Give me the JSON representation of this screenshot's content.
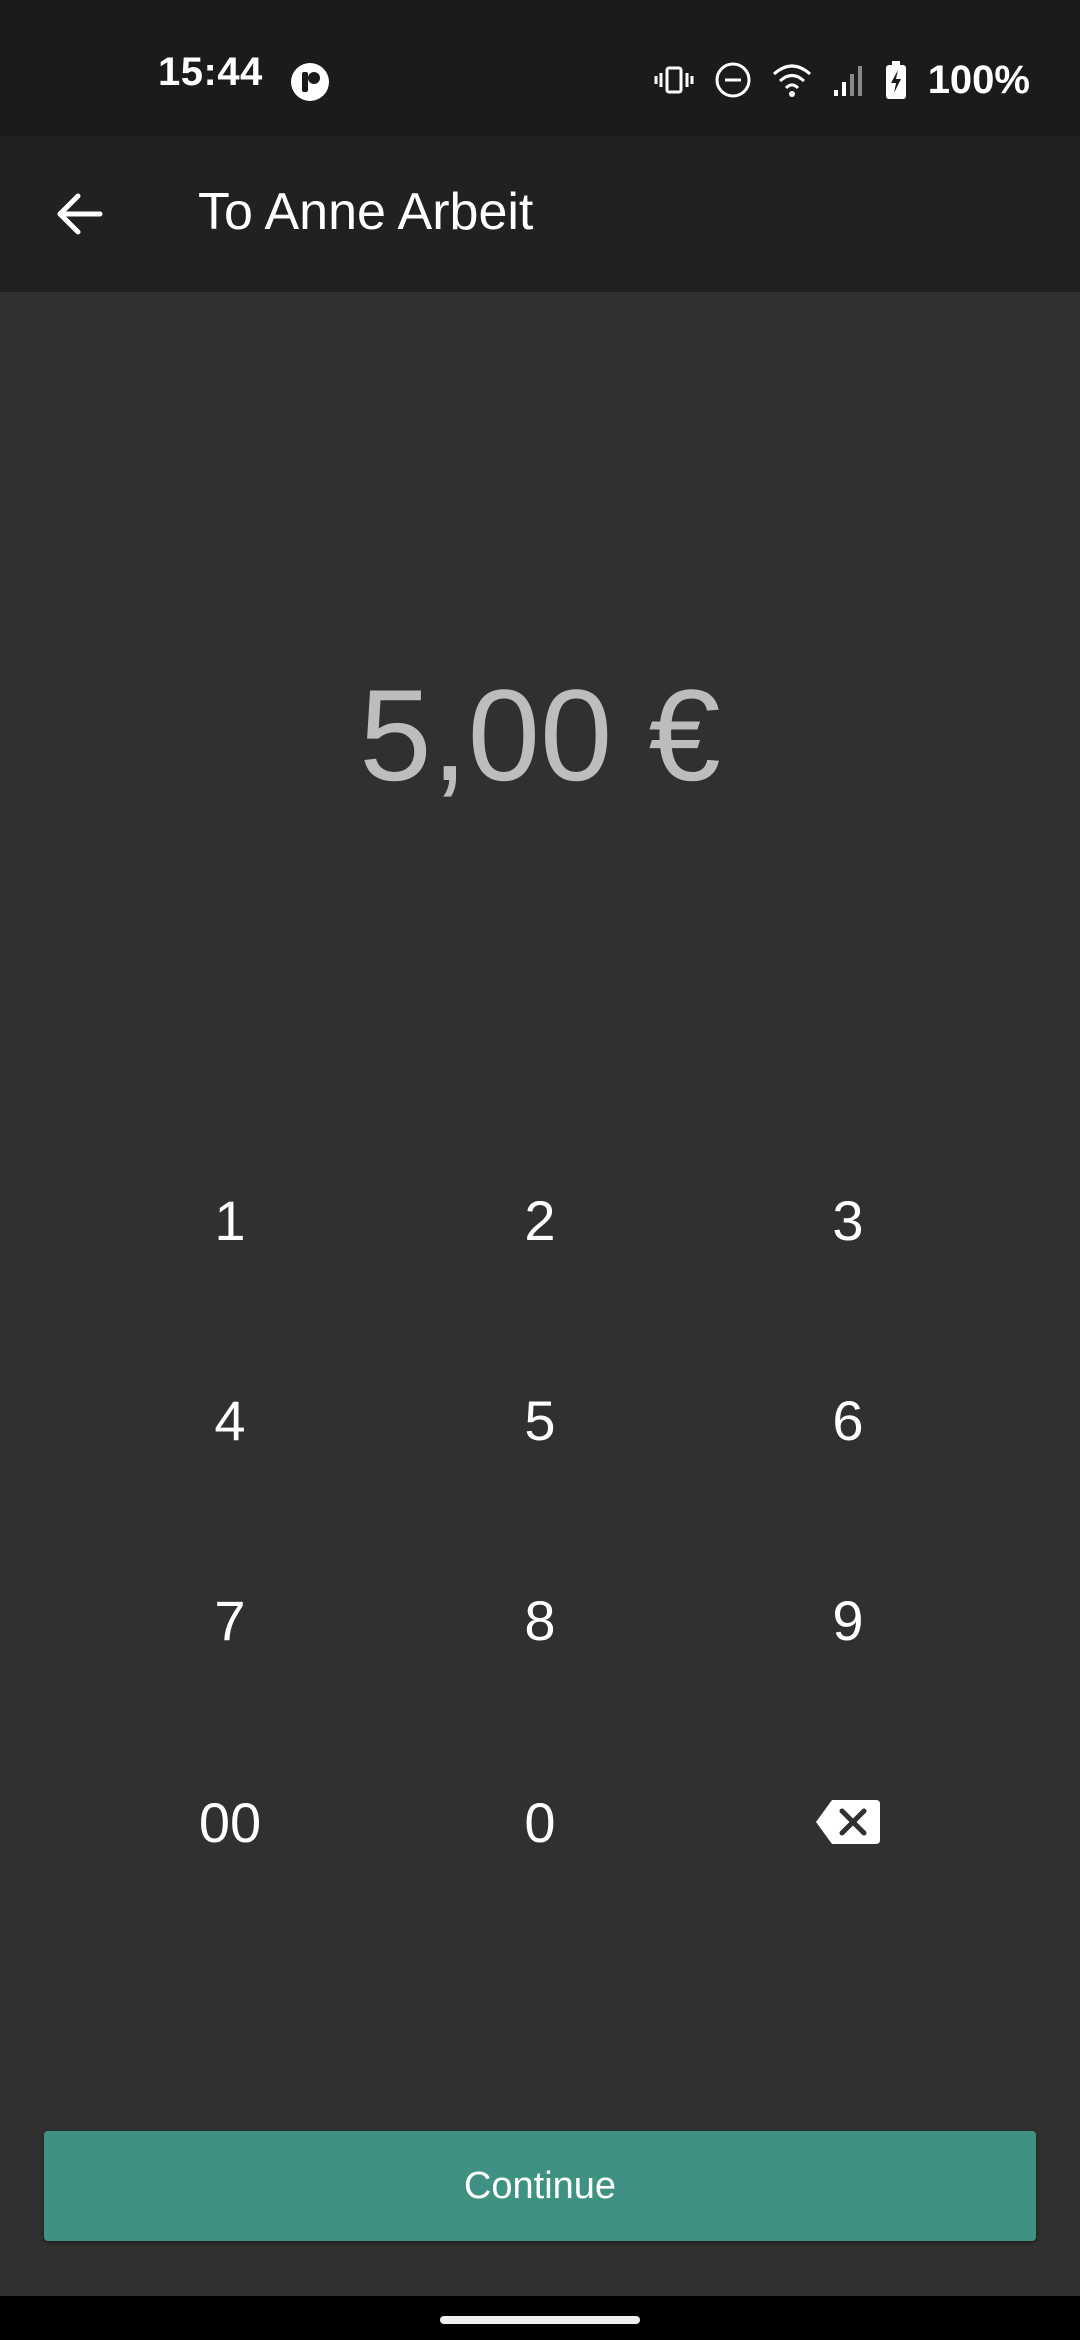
{
  "status_bar": {
    "time": "15:44",
    "battery": "100%",
    "icons": [
      "vibrate-icon",
      "do-not-disturb-icon",
      "wifi-icon",
      "signal-icon",
      "battery-charging-icon"
    ]
  },
  "app_bar": {
    "title": "To Anne Arbeit",
    "back_icon": "arrow-back-icon"
  },
  "amount": "5,00 €",
  "keypad": {
    "keys": [
      "1",
      "2",
      "3",
      "4",
      "5",
      "6",
      "7",
      "8",
      "9",
      "00",
      "0"
    ],
    "backspace_icon": "backspace-icon"
  },
  "continue_label": "Continue",
  "colors": {
    "background": "#303030",
    "app_bar": "#212121",
    "status_bar": "#1b1b1b",
    "accent": "#3f9283",
    "amount_text": "#bdbdbd"
  }
}
